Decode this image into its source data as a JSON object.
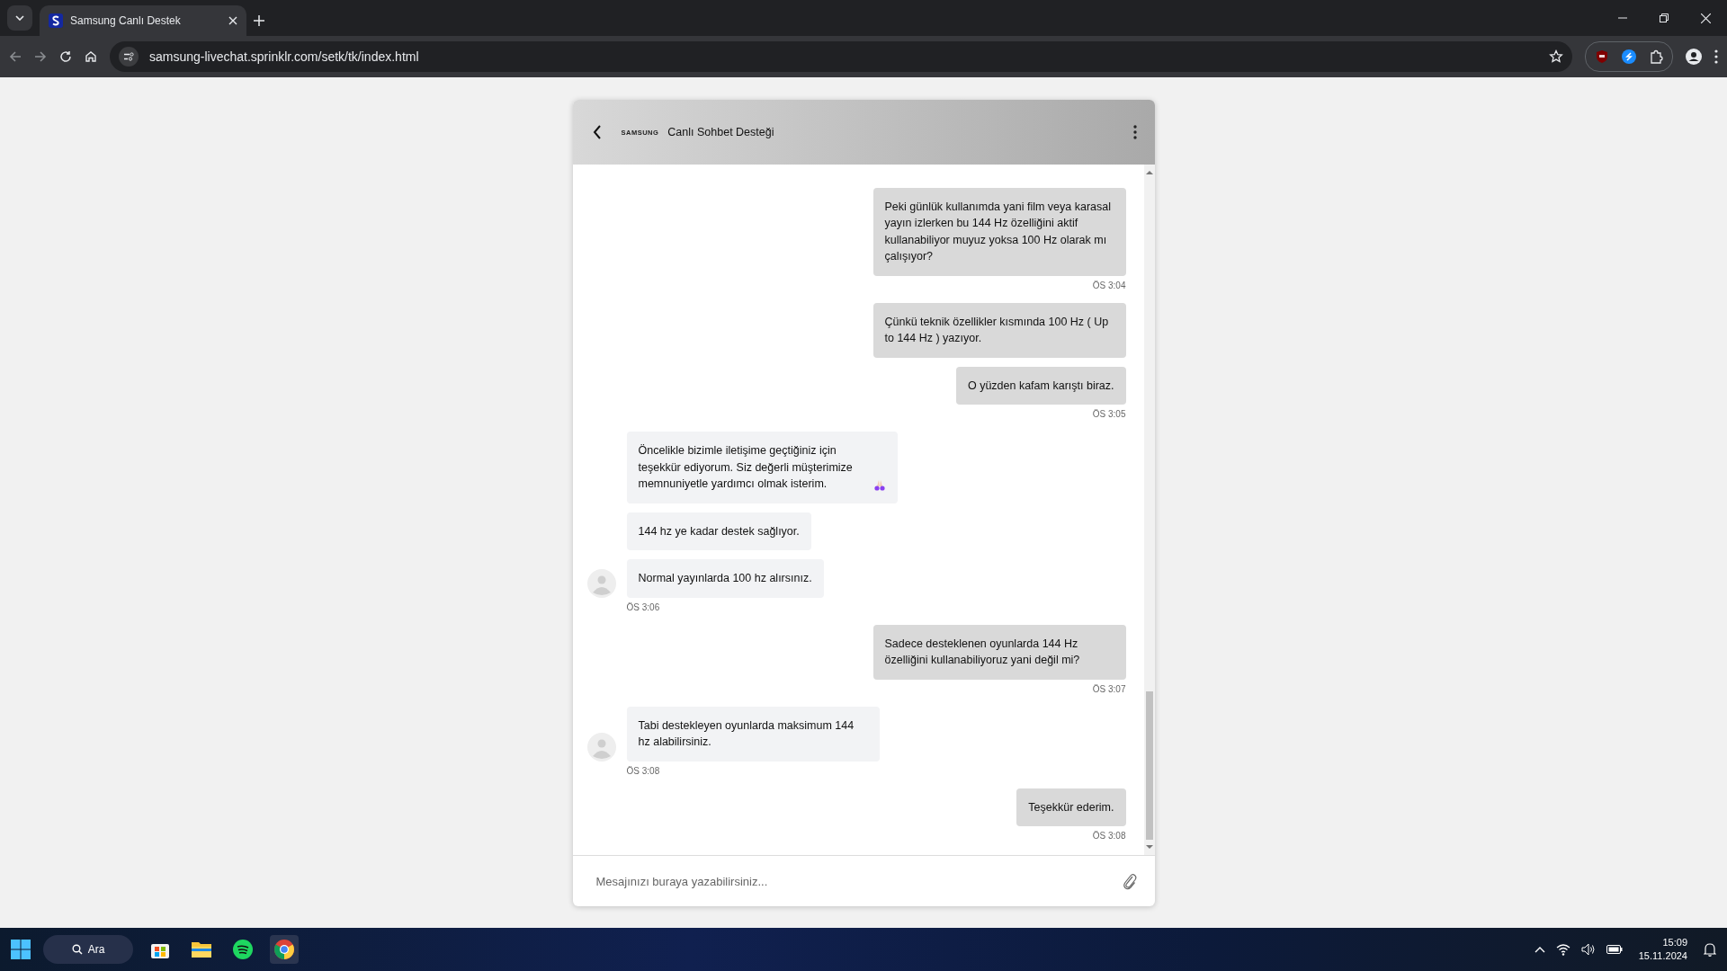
{
  "browser": {
    "tab": {
      "title": "Samsung Canlı Destek",
      "selected": true
    },
    "url": "samsung-livechat.sprinklr.com/setk/tk/index.html"
  },
  "chat": {
    "logo": "SAMSUNG",
    "title": "Canlı Sohbet Desteği",
    "messages": [
      {
        "kind": "user",
        "text": "Peki günlük kullanımda yani film veya karasal yayın izlerken bu 144 Hz özelliğini aktif kullanabiliyor muyuz yoksa 100 Hz olarak mı çalışıyor?",
        "time": "ÖS 3:04"
      },
      {
        "kind": "user",
        "text": "Çünkü teknik özellikler kısmında 100 Hz ( Up to 144 Hz ) yazıyor."
      },
      {
        "kind": "user",
        "text": "O yüzden kafam karıştı biraz.",
        "time": "ÖS 3:05"
      },
      {
        "kind": "agent",
        "text": "Öncelikle bizimle iletişime geçtiğiniz için teşekkür ediyorum. Siz değerli müşterimize memnuniyetle yardımcı olmak isterim.",
        "emoji": true,
        "avatar": false
      },
      {
        "kind": "agent",
        "text": "144 hz ye kadar destek sağlıyor.",
        "emoji": false,
        "avatar": false
      },
      {
        "kind": "agent",
        "text": "Normal yayınlarda 100 hz alırsınız.",
        "emoji": false,
        "avatar": true,
        "time": "ÖS 3:06"
      },
      {
        "kind": "user",
        "text": "Sadece desteklenen oyunlarda 144 Hz özelliğini kullanabiliyoruz yani değil mi?",
        "time": "ÖS 3:07"
      },
      {
        "kind": "agent",
        "text": "Tabi destekleyen oyunlarda maksimum 144 hz alabilirsiniz.",
        "emoji": false,
        "avatar": true,
        "time": "ÖS 3:08"
      },
      {
        "kind": "user",
        "text": "Teşekkür ederim.",
        "time": "ÖS 3:08"
      }
    ],
    "input": {
      "placeholder": "Mesajınızı buraya yazabilirsiniz..."
    }
  },
  "taskbar": {
    "search": "Ara",
    "time": "15:09",
    "date": "15.11.2024"
  }
}
